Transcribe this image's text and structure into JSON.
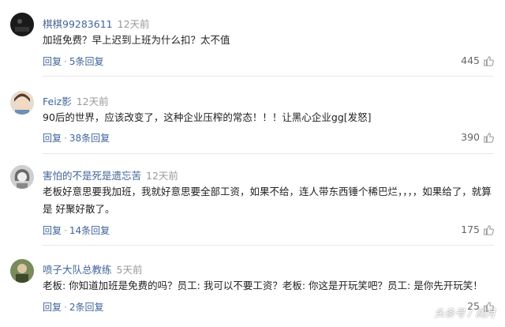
{
  "comments": [
    {
      "username": "棋棋99283611",
      "time": "12天前",
      "text": "加班免费？早上迟到上班为什么扣？太不值",
      "reply_label": "回复",
      "reply_count_label": "5条回复",
      "likes": "445",
      "avatar": "black-circle-avatar"
    },
    {
      "username": "Feiz影",
      "time": "12天前",
      "text": "90后的世界，应该改变了，这种企业压榨的常态！！！让黑心企业gg[发怒]",
      "reply_label": "回复",
      "reply_count_label": "38条回复",
      "likes": "390",
      "avatar": "anime-boy-avatar"
    },
    {
      "username": "害怕的不是死是遗忘苦",
      "time": "12天前",
      "text": "老板好意思要我加班，我就好意思要全部工资，如果不给，连人带东西锤个稀巴烂，，，，如果给了，就算是 好聚好散了。",
      "reply_label": "回复",
      "reply_count_label": "14条回复",
      "likes": "175",
      "avatar": "grey-girl-avatar"
    },
    {
      "username": "喷子大队总教练",
      "time": "5天前",
      "text": "老板: 你知道加班是免费的吗？员工: 我可以不要工资？老板: 你这是开玩笑吧？员工: 是你先开玩笑！",
      "reply_label": "回复",
      "reply_count_label": "2条回复",
      "likes": "25",
      "avatar": "green-figure-avatar"
    }
  ],
  "separator": "·",
  "watermark": "头条号 / 澜月",
  "colors": {
    "link": "#406599",
    "time": "#999999",
    "text": "#222222"
  }
}
